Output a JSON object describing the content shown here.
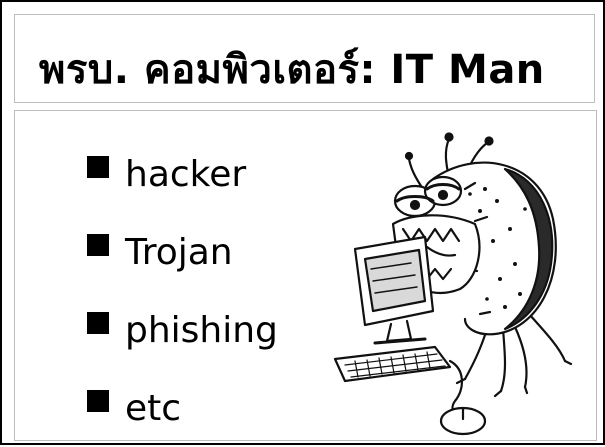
{
  "slide": {
    "title": "พรบ. คอมพิวเตอร์: IT Man",
    "bullets": [
      {
        "label": "hacker"
      },
      {
        "label": "Trojan"
      },
      {
        "label": "phishing"
      },
      {
        "label": "etc"
      }
    ],
    "illustration": {
      "icon": "computer-bug-cartoon-icon"
    }
  },
  "colors": {
    "background": "#ffffff",
    "text": "#000000",
    "panel_border": "#bdbdbd"
  }
}
